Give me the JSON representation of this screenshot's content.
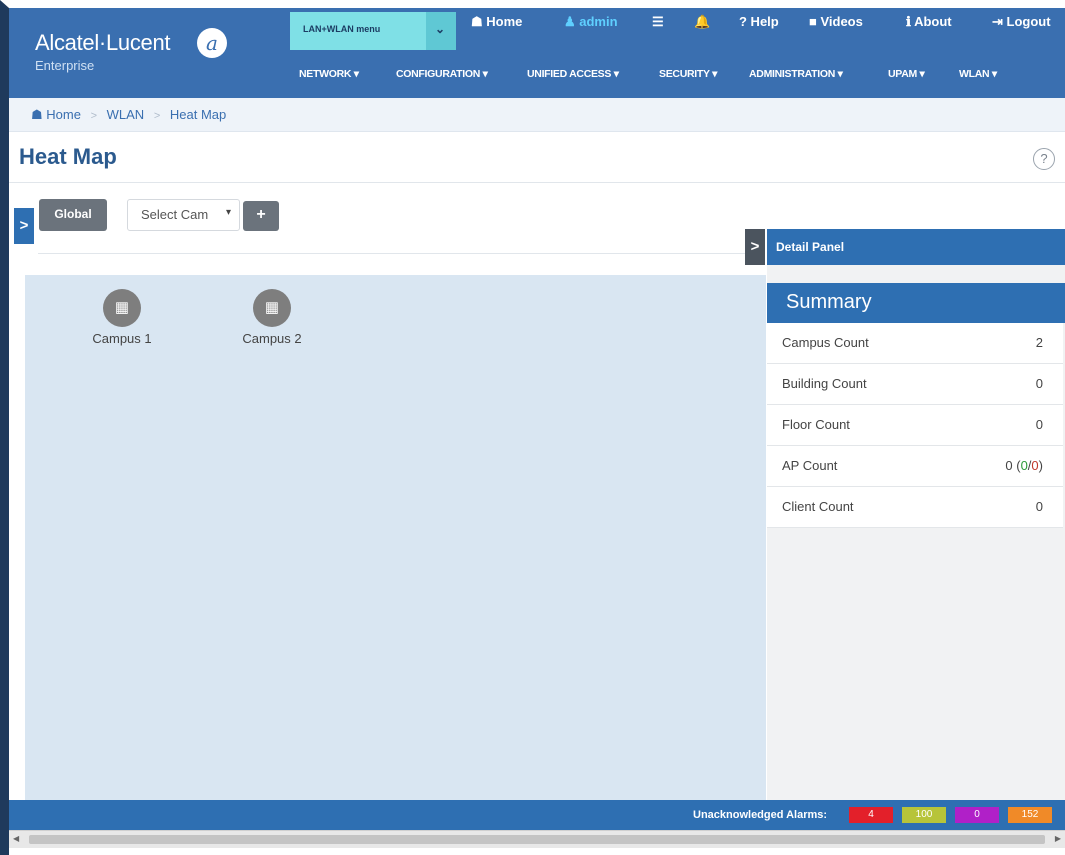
{
  "header": {
    "logo_text": "Alcatel·Lucent",
    "logo_sub": "Enterprise",
    "lanwlan_menu": "LAN+WLAN menu",
    "links": {
      "home": "☗ Home",
      "admin": "♟ admin",
      "menu": "☰",
      "alerts": "🔔",
      "help": "? Help",
      "videos": "■ Videos",
      "about": "ℹ About",
      "logout": "⇥ Logout"
    },
    "nav": [
      "NETWORK ▾",
      "CONFIGURATION ▾",
      "UNIFIED ACCESS ▾",
      "SECURITY ▾",
      "ADMINISTRATION ▾",
      "UPAM ▾",
      "WLAN ▾"
    ]
  },
  "breadcrumb": {
    "home": "☗ Home",
    "wlan": "WLAN",
    "current": "Heat Map",
    "sep": ">"
  },
  "page": {
    "title": "Heat Map",
    "help": "?"
  },
  "toolbar": {
    "toggle": ">",
    "global": "Global",
    "campus_select": "Select Cam",
    "caret": "▾",
    "add": "+"
  },
  "map": {
    "campuses": [
      {
        "label": "Campus 1",
        "icon": "▦"
      },
      {
        "label": "Campus 2",
        "icon": "▦"
      }
    ]
  },
  "detail_panel": {
    "toggle": ">",
    "title": "Detail Panel",
    "summary_title": "Summary",
    "rows": [
      {
        "label": "Campus Count",
        "value": "2"
      },
      {
        "label": "Building Count",
        "value": "0"
      },
      {
        "label": "Floor Count",
        "value": "0"
      },
      {
        "label": "AP Count",
        "value": "0",
        "up": "0",
        "down": "0"
      },
      {
        "label": "Client Count",
        "value": "0"
      }
    ]
  },
  "footer": {
    "alarms_label": "Unacknowledged Alarms:",
    "alarms": [
      {
        "value": "4",
        "color": "#e3202a"
      },
      {
        "value": "100",
        "color": "#b7c43a"
      },
      {
        "value": "0",
        "color": "#b020c8"
      },
      {
        "value": "152",
        "color": "#f08a28"
      }
    ]
  }
}
